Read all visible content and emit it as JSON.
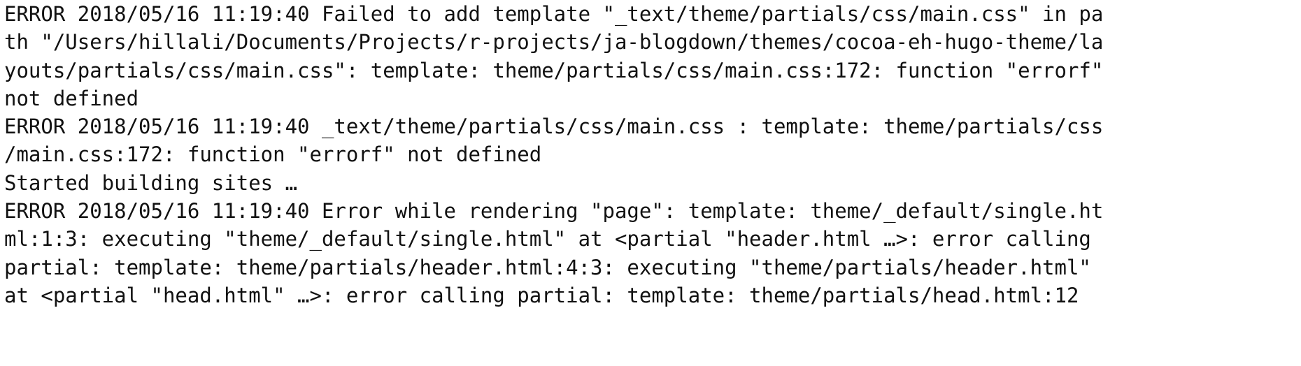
{
  "terminal": {
    "lines": [
      "ERROR 2018/05/16 11:19:40 Failed to add template \"_text/theme/partials/css/main.css\" in pa",
      "th \"/Users/hillali/Documents/Projects/r-projects/ja-blogdown/themes/cocoa-eh-hugo-theme/la",
      "youts/partials/css/main.css\": template: theme/partials/css/main.css:172: function \"errorf\"",
      "not defined",
      "ERROR 2018/05/16 11:19:40 _text/theme/partials/css/main.css : template: theme/partials/css",
      "/main.css:172: function \"errorf\" not defined",
      "Started building sites …",
      "ERROR 2018/05/16 11:19:40 Error while rendering \"page\": template: theme/_default/single.ht",
      "ml:1:3: executing \"theme/_default/single.html\" at <partial \"header.html …>: error calling",
      "partial: template: theme/partials/header.html:4:3: executing \"theme/partials/header.html\"",
      "at <partial \"head.html\" …>: error calling partial: template: theme/partials/head.html:12"
    ]
  }
}
